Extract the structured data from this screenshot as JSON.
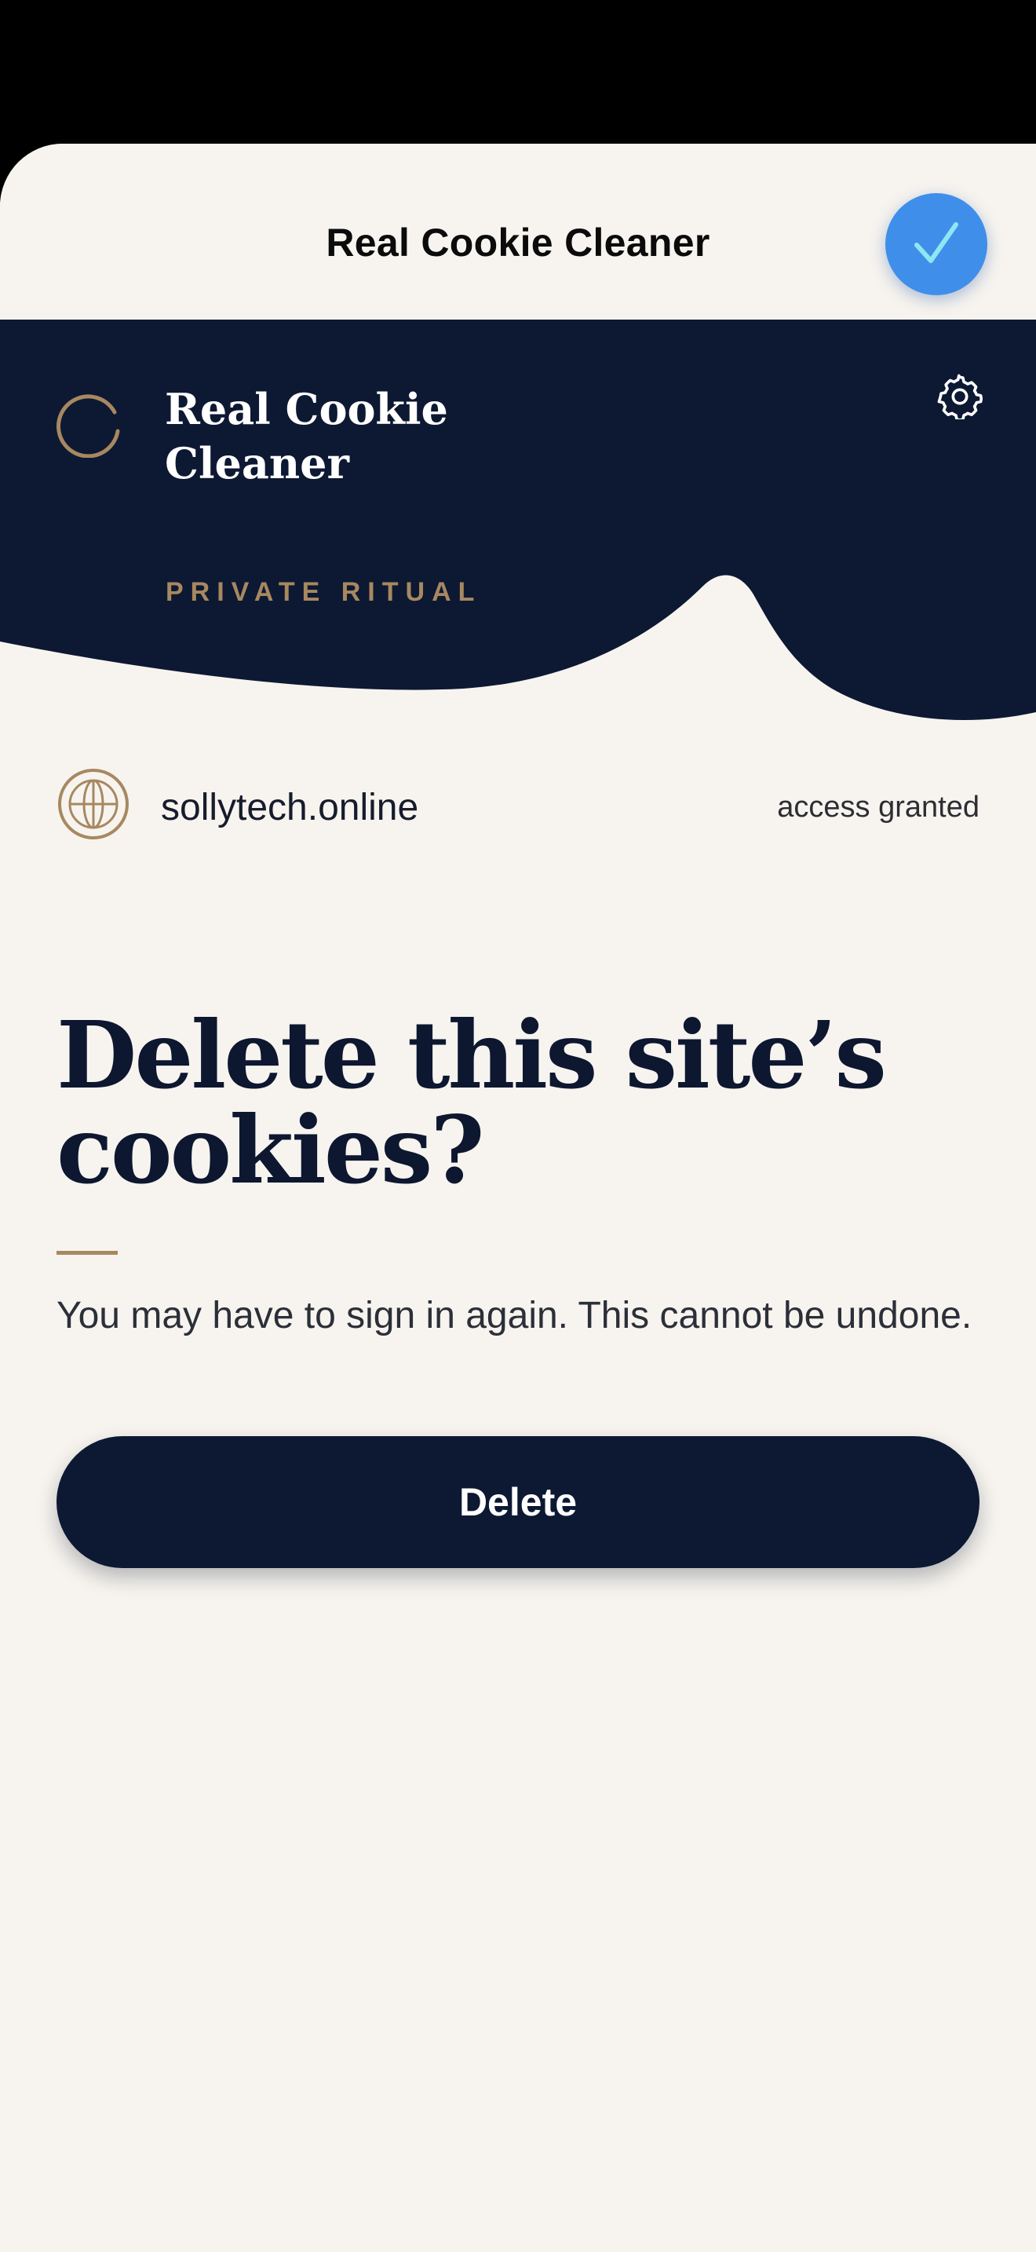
{
  "sheet": {
    "title": "Real Cookie Cleaner",
    "done_icon": "checkmark-icon"
  },
  "hero": {
    "brand_name": "Real Cookie Cleaner",
    "tagline": "PRIVATE RITUAL",
    "settings_icon": "gear-icon",
    "status_icon": "spinner-icon"
  },
  "site": {
    "icon": "globe-icon",
    "domain": "sollytech.online",
    "status": "access granted"
  },
  "prompt": {
    "heading": "Delete this site’s cookies?",
    "message": "You may have to sign in again. This cannot be undone.",
    "delete_label": "Delete"
  },
  "colors": {
    "navy": "#0d1933",
    "gold": "#a78860",
    "cream": "#f7f4ef",
    "accent_blue": "#3f8fea"
  }
}
